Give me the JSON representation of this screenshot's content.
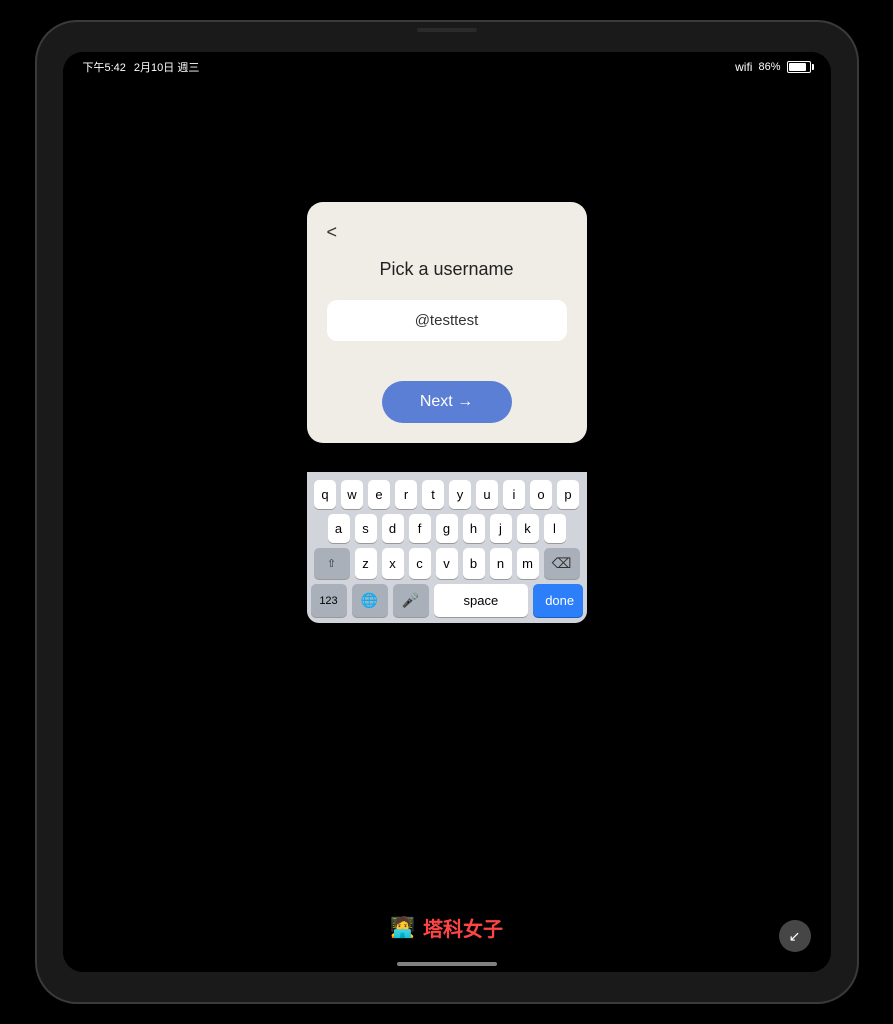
{
  "statusBar": {
    "time": "下午5:42",
    "date": "2月10日 週三",
    "wifi": "▾",
    "battery": "86%"
  },
  "modal": {
    "backButton": "<",
    "title": "Pick a username",
    "inputValue": "@testtest",
    "inputPlaceholder": "@testtest",
    "nextButton": "Next →"
  },
  "keyboard": {
    "row1": [
      "q",
      "w",
      "e",
      "r",
      "t",
      "y",
      "u",
      "i",
      "o",
      "p"
    ],
    "row2": [
      "a",
      "s",
      "d",
      "f",
      "g",
      "h",
      "j",
      "k",
      "l"
    ],
    "row3": [
      "z",
      "x",
      "c",
      "v",
      "b",
      "n",
      "m"
    ],
    "bottomBar": {
      "key123": "123",
      "keySpace": "space",
      "keyDone": "done"
    }
  },
  "watermark": {
    "icon": "🧑‍💻",
    "text": "塔科女子"
  },
  "expandIcon": "↙"
}
